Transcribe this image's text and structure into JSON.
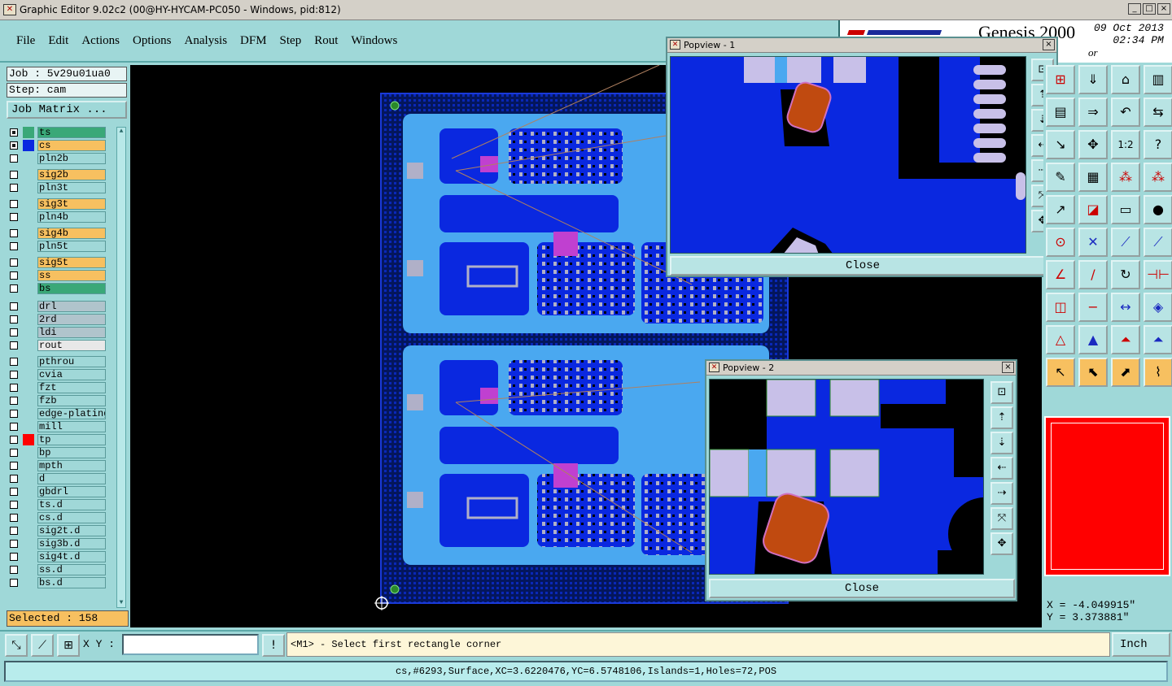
{
  "window": {
    "title": "Graphic Editor 9.02c2 (00@HY-HYCAM-PC050 - Windows, pid:812)",
    "min": "_",
    "max": "□",
    "close": "×"
  },
  "menu": {
    "items": [
      "File",
      "Edit",
      "Actions",
      "Options",
      "Analysis",
      "DFM",
      "Step",
      "Rout",
      "Windows"
    ]
  },
  "brand": {
    "name": "Genesis 2000",
    "sub": "or",
    "date": "09 Oct 2013",
    "time": "02:34 PM"
  },
  "job": {
    "job_label": "Job : 5v29u01ua0",
    "step_label": "Step: cam",
    "matrix_label": "Job Matrix ...",
    "selected_label": "Selected : 158"
  },
  "layers": [
    {
      "name": "ts",
      "type": "sel",
      "on": true,
      "swatch": "#3aa878"
    },
    {
      "name": "cs",
      "type": "sig",
      "on": true,
      "swatch": "#0a28e0"
    },
    {
      "name": "pln2b",
      "type": "pln",
      "on": false,
      "swatch": ""
    },
    {
      "name": "sig2b",
      "type": "sig",
      "on": false,
      "swatch": ""
    },
    {
      "name": "pln3t",
      "type": "pln",
      "on": false,
      "swatch": ""
    },
    {
      "name": "sig3t",
      "type": "sig",
      "on": false,
      "swatch": ""
    },
    {
      "name": "pln4b",
      "type": "pln",
      "on": false,
      "swatch": ""
    },
    {
      "name": "sig4b",
      "type": "sig",
      "on": false,
      "swatch": ""
    },
    {
      "name": "pln5t",
      "type": "pln",
      "on": false,
      "swatch": ""
    },
    {
      "name": "sig5t",
      "type": "sig",
      "on": false,
      "swatch": ""
    },
    {
      "name": "ss",
      "type": "sig",
      "on": false,
      "swatch": ""
    },
    {
      "name": "bs",
      "type": "sel",
      "on": false,
      "swatch": ""
    },
    {
      "name": "drl",
      "type": "drl",
      "on": false,
      "swatch": ""
    },
    {
      "name": "2rd",
      "type": "drl",
      "on": false,
      "swatch": ""
    },
    {
      "name": "ldi",
      "type": "drl",
      "on": false,
      "swatch": ""
    },
    {
      "name": "rout",
      "type": "rout",
      "on": false,
      "swatch": ""
    },
    {
      "name": "pthrou",
      "type": "pln",
      "on": false,
      "swatch": ""
    },
    {
      "name": "cvia",
      "type": "pln",
      "on": false,
      "swatch": ""
    },
    {
      "name": "fzt",
      "type": "pln",
      "on": false,
      "swatch": ""
    },
    {
      "name": "fzb",
      "type": "pln",
      "on": false,
      "swatch": ""
    },
    {
      "name": "edge-plating",
      "type": "pln",
      "on": false,
      "swatch": ""
    },
    {
      "name": "mill",
      "type": "pln",
      "on": false,
      "swatch": ""
    },
    {
      "name": "tp",
      "type": "pln",
      "on": false,
      "swatch": "#ff0000"
    },
    {
      "name": "bp",
      "type": "pln",
      "on": false,
      "swatch": ""
    },
    {
      "name": "mpth",
      "type": "pln",
      "on": false,
      "swatch": ""
    },
    {
      "name": "d",
      "type": "pln",
      "on": false,
      "swatch": ""
    },
    {
      "name": "gbdrl",
      "type": "pln",
      "on": false,
      "swatch": ""
    },
    {
      "name": "ts.d",
      "type": "pln",
      "on": false,
      "swatch": ""
    },
    {
      "name": "cs.d",
      "type": "pln",
      "on": false,
      "swatch": ""
    },
    {
      "name": "sig2t.d",
      "type": "pln",
      "on": false,
      "swatch": ""
    },
    {
      "name": "sig3b.d",
      "type": "pln",
      "on": false,
      "swatch": ""
    },
    {
      "name": "sig4t.d",
      "type": "pln",
      "on": false,
      "swatch": ""
    },
    {
      "name": "ss.d",
      "type": "pln",
      "on": false,
      "swatch": ""
    },
    {
      "name": "bs.d",
      "type": "pln",
      "on": false,
      "swatch": ""
    }
  ],
  "popview1": {
    "title": "Popview - 1",
    "close_label": "Close"
  },
  "popview2": {
    "title": "Popview - 2",
    "close_label": "Close"
  },
  "popview_tools": [
    "zoom-home-icon",
    "pan-up-icon",
    "pan-down-icon",
    "pan-left-icon",
    "pan-right-icon",
    "zoom-fit-icon",
    "zoom-center-icon"
  ],
  "right_tools": [
    {
      "icon": "graph-icon",
      "glyph": "⊞",
      "cls": "red"
    },
    {
      "icon": "monitor-down-icon",
      "glyph": "⇓",
      "cls": ""
    },
    {
      "icon": "home-icon",
      "glyph": "⌂",
      "cls": ""
    },
    {
      "icon": "split-icon",
      "glyph": "▥",
      "cls": ""
    },
    {
      "icon": "layer-icon",
      "glyph": "▤",
      "cls": ""
    },
    {
      "icon": "layer-right-icon",
      "glyph": "⇒",
      "cls": ""
    },
    {
      "icon": "undo-icon",
      "glyph": "↶",
      "cls": ""
    },
    {
      "icon": "swap-icon",
      "glyph": "⇆",
      "cls": ""
    },
    {
      "icon": "zoom-out-icon",
      "glyph": "↘",
      "cls": ""
    },
    {
      "icon": "move-icon",
      "glyph": "✥",
      "cls": ""
    },
    {
      "icon": "scale-icon",
      "glyph": "1:2",
      "cls": ""
    },
    {
      "icon": "help-icon",
      "glyph": "?",
      "cls": ""
    },
    {
      "icon": "pencil-icon",
      "glyph": "✎",
      "cls": ""
    },
    {
      "icon": "grid-icon",
      "glyph": "▦",
      "cls": ""
    },
    {
      "icon": "snap-icon",
      "glyph": "⁂",
      "cls": "red"
    },
    {
      "icon": "snap2-icon",
      "glyph": "⁂",
      "cls": "red"
    },
    {
      "icon": "pick-icon",
      "glyph": "↗",
      "cls": ""
    },
    {
      "icon": "draw-icon",
      "glyph": "◪",
      "cls": "red"
    },
    {
      "icon": "ruler-icon",
      "glyph": "▭",
      "cls": ""
    },
    {
      "icon": "pad-icon",
      "glyph": "●",
      "cls": ""
    },
    {
      "icon": "via-icon",
      "glyph": "⊙",
      "cls": "red"
    },
    {
      "icon": "cross-icon",
      "glyph": "✕",
      "cls": "blue"
    },
    {
      "icon": "line-icon",
      "glyph": "⟋",
      "cls": "blue"
    },
    {
      "icon": "line2-icon",
      "glyph": "⟋",
      "cls": "blue"
    },
    {
      "icon": "angle-icon",
      "glyph": "∠",
      "cls": "red"
    },
    {
      "icon": "slash-icon",
      "glyph": "/",
      "cls": "red"
    },
    {
      "icon": "arc-icon",
      "glyph": "↻",
      "cls": ""
    },
    {
      "icon": "mirror-icon",
      "glyph": "⊣⊢",
      "cls": "red"
    },
    {
      "icon": "square-icon",
      "glyph": "◫",
      "cls": "red"
    },
    {
      "icon": "minus-icon",
      "glyph": "−",
      "cls": "red"
    },
    {
      "icon": "measure-icon",
      "glyph": "↔",
      "cls": "blue"
    },
    {
      "icon": "shapes-icon",
      "glyph": "◈",
      "cls": "blue"
    },
    {
      "icon": "triangle-icon",
      "glyph": "△",
      "cls": "red"
    },
    {
      "icon": "triangle-up-icon",
      "glyph": "▲",
      "cls": "blue"
    },
    {
      "icon": "triangle-arrow-icon",
      "glyph": "⏶",
      "cls": "red"
    },
    {
      "icon": "triangle-blue-icon",
      "glyph": "⏶",
      "cls": "blue"
    },
    {
      "icon": "cursor-icon",
      "glyph": "↖",
      "cls": "y"
    },
    {
      "icon": "cursor-box-icon",
      "glyph": "⬉",
      "cls": "y"
    },
    {
      "icon": "cursor-select-icon",
      "glyph": "⬈",
      "cls": "y"
    },
    {
      "icon": "route-icon",
      "glyph": "⌇",
      "cls": "y"
    }
  ],
  "coords": {
    "x": "X = -4.049915\"",
    "y": "Y = 3.373881\""
  },
  "bottom": {
    "xy_label": "X Y :",
    "xy_value": "",
    "prompt": "<M1> - Select first rectangle corner",
    "units": "Inch",
    "status": "cs,#6293,Surface,XC=3.6220476,YC=6.5748106,Islands=1,Holes=72,POS"
  }
}
